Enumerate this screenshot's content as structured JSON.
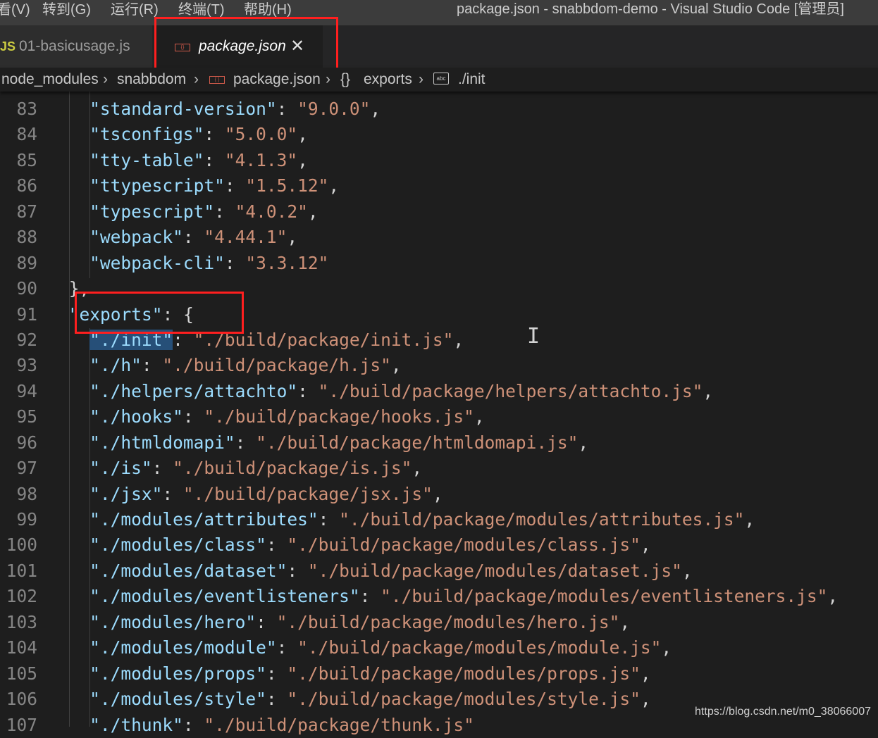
{
  "window": {
    "title": "package.json - snabbdom-demo - Visual Studio Code [管理员]"
  },
  "menu": {
    "items": [
      "看(V)",
      "转到(G)",
      "运行(R)",
      "终端(T)",
      "帮助(H)"
    ]
  },
  "tabs": [
    {
      "label": "01-basicusage.js",
      "icon": "JS",
      "active": false
    },
    {
      "label": "package.json",
      "icon": "{}",
      "active": true,
      "close": "✕"
    }
  ],
  "breadcrumb": {
    "items": [
      "node_modules",
      "snabbdom",
      "package.json",
      "exports",
      "./init"
    ],
    "exports_icon": "{}",
    "init_icon": "abc",
    "json_icon": "{ }"
  },
  "editor": {
    "lines": [
      {
        "n": "83",
        "indent": 4,
        "key": "\"standard-version\"",
        "sep": ": ",
        "val": "\"9.0.0\"",
        "end": ","
      },
      {
        "n": "84",
        "indent": 4,
        "key": "\"tsconfigs\"",
        "sep": ": ",
        "val": "\"5.0.0\"",
        "end": ","
      },
      {
        "n": "85",
        "indent": 4,
        "key": "\"tty-table\"",
        "sep": ": ",
        "val": "\"4.1.3\"",
        "end": ","
      },
      {
        "n": "86",
        "indent": 4,
        "key": "\"ttypescript\"",
        "sep": ": ",
        "val": "\"1.5.12\"",
        "end": ","
      },
      {
        "n": "87",
        "indent": 4,
        "key": "\"typescript\"",
        "sep": ": ",
        "val": "\"4.0.2\"",
        "end": ","
      },
      {
        "n": "88",
        "indent": 4,
        "key": "\"webpack\"",
        "sep": ": ",
        "val": "\"4.44.1\"",
        "end": ","
      },
      {
        "n": "89",
        "indent": 4,
        "key": "\"webpack-cli\"",
        "sep": ": ",
        "val": "\"3.3.12\"",
        "end": ""
      },
      {
        "n": "90",
        "indent": 2,
        "key": "",
        "sep": "},",
        "val": "",
        "end": ""
      },
      {
        "n": "91",
        "indent": 2,
        "key": "\"exports\"",
        "sep": ": {",
        "val": "",
        "end": ""
      },
      {
        "n": "92",
        "indent": 4,
        "key": "\"./init\"",
        "sep": ": ",
        "val": "\"./build/package/init.js\"",
        "end": ",",
        "selected": true
      },
      {
        "n": "93",
        "indent": 4,
        "key": "\"./h\"",
        "sep": ": ",
        "val": "\"./build/package/h.js\"",
        "end": ","
      },
      {
        "n": "94",
        "indent": 4,
        "key": "\"./helpers/attachto\"",
        "sep": ": ",
        "val": "\"./build/package/helpers/attachto.js\"",
        "end": ","
      },
      {
        "n": "95",
        "indent": 4,
        "key": "\"./hooks\"",
        "sep": ": ",
        "val": "\"./build/package/hooks.js\"",
        "end": ","
      },
      {
        "n": "96",
        "indent": 4,
        "key": "\"./htmldomapi\"",
        "sep": ": ",
        "val": "\"./build/package/htmldomapi.js\"",
        "end": ","
      },
      {
        "n": "97",
        "indent": 4,
        "key": "\"./is\"",
        "sep": ": ",
        "val": "\"./build/package/is.js\"",
        "end": ","
      },
      {
        "n": "98",
        "indent": 4,
        "key": "\"./jsx\"",
        "sep": ": ",
        "val": "\"./build/package/jsx.js\"",
        "end": ","
      },
      {
        "n": "99",
        "indent": 4,
        "key": "\"./modules/attributes\"",
        "sep": ": ",
        "val": "\"./build/package/modules/attributes.js\"",
        "end": ","
      },
      {
        "n": "100",
        "indent": 4,
        "key": "\"./modules/class\"",
        "sep": ": ",
        "val": "\"./build/package/modules/class.js\"",
        "end": ","
      },
      {
        "n": "101",
        "indent": 4,
        "key": "\"./modules/dataset\"",
        "sep": ": ",
        "val": "\"./build/package/modules/dataset.js\"",
        "end": ","
      },
      {
        "n": "102",
        "indent": 4,
        "key": "\"./modules/eventlisteners\"",
        "sep": ": ",
        "val": "\"./build/package/modules/eventlisteners.js\"",
        "end": ","
      },
      {
        "n": "103",
        "indent": 4,
        "key": "\"./modules/hero\"",
        "sep": ": ",
        "val": "\"./build/package/modules/hero.js\"",
        "end": ","
      },
      {
        "n": "104",
        "indent": 4,
        "key": "\"./modules/module\"",
        "sep": ": ",
        "val": "\"./build/package/modules/module.js\"",
        "end": ","
      },
      {
        "n": "105",
        "indent": 4,
        "key": "\"./modules/props\"",
        "sep": ": ",
        "val": "\"./build/package/modules/props.js\"",
        "end": ","
      },
      {
        "n": "106",
        "indent": 4,
        "key": "\"./modules/style\"",
        "sep": ": ",
        "val": "\"./build/package/modules/style.js\"",
        "end": ","
      },
      {
        "n": "107",
        "indent": 4,
        "key": "\"./thunk\"",
        "sep": ": ",
        "val": "\"./build/package/thunk.js\"",
        "end": ""
      }
    ]
  },
  "watermark": "https://blog.csdn.net/m0_38066007",
  "colors": {
    "background": "#1e1e1e",
    "key": "#9cdcfe",
    "string": "#ce9178",
    "selection": "#264f78",
    "highlight_box": "#ff1f1f"
  }
}
